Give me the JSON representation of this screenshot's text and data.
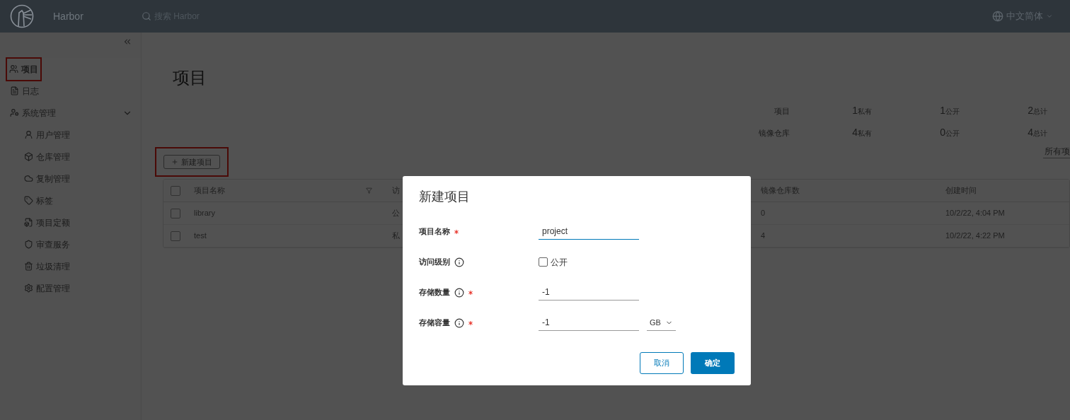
{
  "header": {
    "brand": "Harbor",
    "search": {
      "placeholder": "搜索 Harbor"
    },
    "language": "中文简体"
  },
  "sidebar": {
    "items": [
      {
        "label": "项目",
        "selected": true,
        "highlighted": true
      },
      {
        "label": "日志",
        "selected": false,
        "highlighted": false
      },
      {
        "label": "系统管理",
        "selected": false,
        "highlighted": false,
        "expanded": true,
        "children": [
          {
            "label": "用户管理",
            "selected": false
          },
          {
            "label": "仓库管理",
            "selected": false
          },
          {
            "label": "复制管理",
            "selected": false
          },
          {
            "label": "标签",
            "selected": false
          },
          {
            "label": "项目定额",
            "selected": false
          },
          {
            "label": "审查服务",
            "selected": false
          },
          {
            "label": "垃圾清理",
            "selected": false
          },
          {
            "label": "配置管理",
            "selected": false
          }
        ]
      }
    ]
  },
  "page": {
    "title": "项目",
    "stats": [
      {
        "label": "项目",
        "cells": [
          {
            "value": "1",
            "unit": "私有"
          },
          {
            "value": "1",
            "unit": "公开"
          },
          {
            "value": "2",
            "unit": "总计"
          }
        ]
      },
      {
        "label": "镜像仓库",
        "cells": [
          {
            "value": "4",
            "unit": "私有"
          },
          {
            "value": "0",
            "unit": "公开"
          },
          {
            "value": "4",
            "unit": "总计"
          }
        ]
      }
    ],
    "new_button": {
      "label": "新建项目",
      "highlighted": true
    },
    "filter": "所有项",
    "table": {
      "select_all": {
        "checked": false
      },
      "columns": [
        "项目名称",
        "访",
        "镜像仓库数",
        "创建时间"
      ],
      "rows": [
        {
          "checked": false,
          "cells": [
            "library",
            "公",
            "0",
            "10/2/22, 4:04 PM"
          ]
        },
        {
          "checked": false,
          "cells": [
            "test",
            "私",
            "4",
            "10/2/22, 4:22 PM"
          ]
        }
      ]
    }
  },
  "dialog": {
    "title": "新建项目",
    "fields": [
      {
        "kind": "text",
        "label": "项目名称",
        "required": true,
        "info": false,
        "value": "project",
        "focused": true
      },
      {
        "kind": "checkbox",
        "label": "访问级别",
        "required": false,
        "info": true,
        "option": "公开",
        "checked": false
      },
      {
        "kind": "text",
        "label": "存储数量",
        "required": true,
        "info": true,
        "value": "-1",
        "focused": false
      },
      {
        "kind": "text_unit",
        "label": "存储容量",
        "required": true,
        "info": true,
        "value": "-1",
        "focused": false,
        "unit": "GB"
      }
    ],
    "buttons": [
      {
        "label": "取消",
        "primary": false
      },
      {
        "label": "确定",
        "primary": true
      }
    ]
  }
}
